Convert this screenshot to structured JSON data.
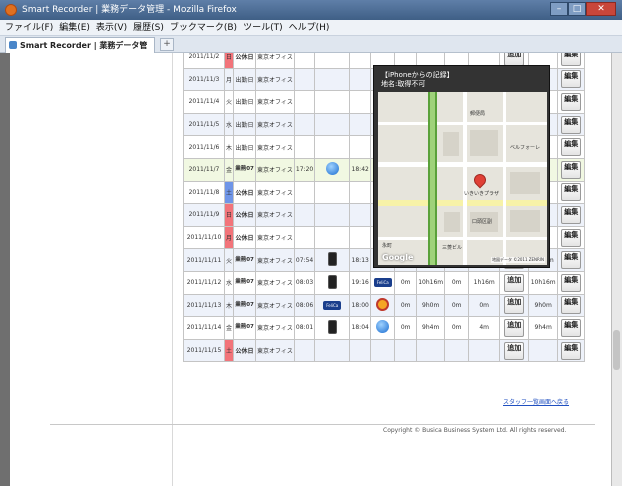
{
  "window": {
    "title": "Smart Recorder | 業務データ管理 - Mozilla Firefox",
    "minimize": "–",
    "maximize": "□",
    "close": "✕"
  },
  "menu": [
    "ファイル(F)",
    "編集(E)",
    "表示(V)",
    "履歴(S)",
    "ブックマーク(B)",
    "ツール(T)",
    "ヘルプ(H)"
  ],
  "tab": {
    "label": "Smart Recorder | 業務データ管理",
    "new_tab": "+"
  },
  "schedule": {
    "rows": [
      {
        "date": "2011/11/2",
        "dow": "日",
        "type": "公休日",
        "place": "東京オフィス",
        "style": "hol"
      },
      {
        "date": "2011/11/3",
        "dow": "月",
        "type": "出勤日",
        "place": "東京オフィス",
        "style": "norm"
      },
      {
        "date": "2011/11/4",
        "dow": "火",
        "type": "出勤日",
        "place": "東京オフィス",
        "style": "norm"
      },
      {
        "date": "2011/11/5",
        "dow": "水",
        "type": "出勤日",
        "place": "東京オフィス",
        "style": "norm"
      },
      {
        "date": "2011/11/6",
        "dow": "木",
        "type": "出勤日",
        "place": "東京オフィス",
        "style": "norm"
      },
      {
        "date": "2011/11/7",
        "dow": "金",
        "type": "業務07",
        "place": "東京オフィス",
        "style": "today",
        "start": "17:20",
        "end": "18:42"
      },
      {
        "date": "2011/11/8",
        "dow": "土",
        "type": "公休日",
        "place": "東京オフィス",
        "style": "sat"
      },
      {
        "date": "2011/11/9",
        "dow": "日",
        "type": "公休日",
        "place": "東京オフィス",
        "style": "hol"
      },
      {
        "date": "2011/11/10",
        "dow": "月",
        "type": "公休日",
        "place": "東京オフィス",
        "style": "hol"
      },
      {
        "date": "2011/11/11",
        "dow": "火",
        "type": "業務07",
        "place": "東京オフィス",
        "style": "work",
        "start": "07:54",
        "end": "18:13",
        "m": "49m",
        "n": "8h24m",
        "o": "0m",
        "p": "13m",
        "q": "8h24m"
      },
      {
        "date": "2011/11/12",
        "dow": "水",
        "type": "業務07",
        "place": "東京オフィス",
        "style": "work",
        "start": "08:03",
        "end": "19:16",
        "m": "0m",
        "n": "10h16m",
        "o": "0m",
        "p": "1h16m",
        "q": "10h16m"
      },
      {
        "date": "2011/11/13",
        "dow": "木",
        "type": "業務07",
        "place": "東京オフィス",
        "style": "work",
        "start": "08:06",
        "end": "18:00",
        "m": "0m",
        "n": "9h0m",
        "o": "0m",
        "p": "0m",
        "q": "9h0m"
      },
      {
        "date": "2011/11/14",
        "dow": "金",
        "type": "業務07",
        "place": "東京オフィス",
        "style": "work",
        "start": "08:01",
        "end": "18:04",
        "m": "0m",
        "n": "9h4m",
        "o": "0m",
        "p": "4m",
        "q": "9h4m"
      },
      {
        "date": "2011/11/15",
        "dow": "土",
        "type": "公休日",
        "place": "東京オフィス",
        "style": "hol"
      }
    ],
    "add_label": "追加",
    "edit_label": "編集",
    "felica_label": "FeliCa"
  },
  "popup": {
    "title": "【iPhoneからの記録】",
    "subtitle": "地名:取得不可",
    "logo": "Google",
    "attribution": "地図データ ©2011 ZENRIN"
  },
  "map_labels": [
    "郵便局",
    "ベルフォーレ",
    "いきいきプラザ",
    "口頭区副",
    "永町",
    "三菱ビル"
  ],
  "staff_link": "スタッフ一覧画面へ戻る",
  "copyright": "Copyright © Busica Business System Ltd. All rights reserved."
}
